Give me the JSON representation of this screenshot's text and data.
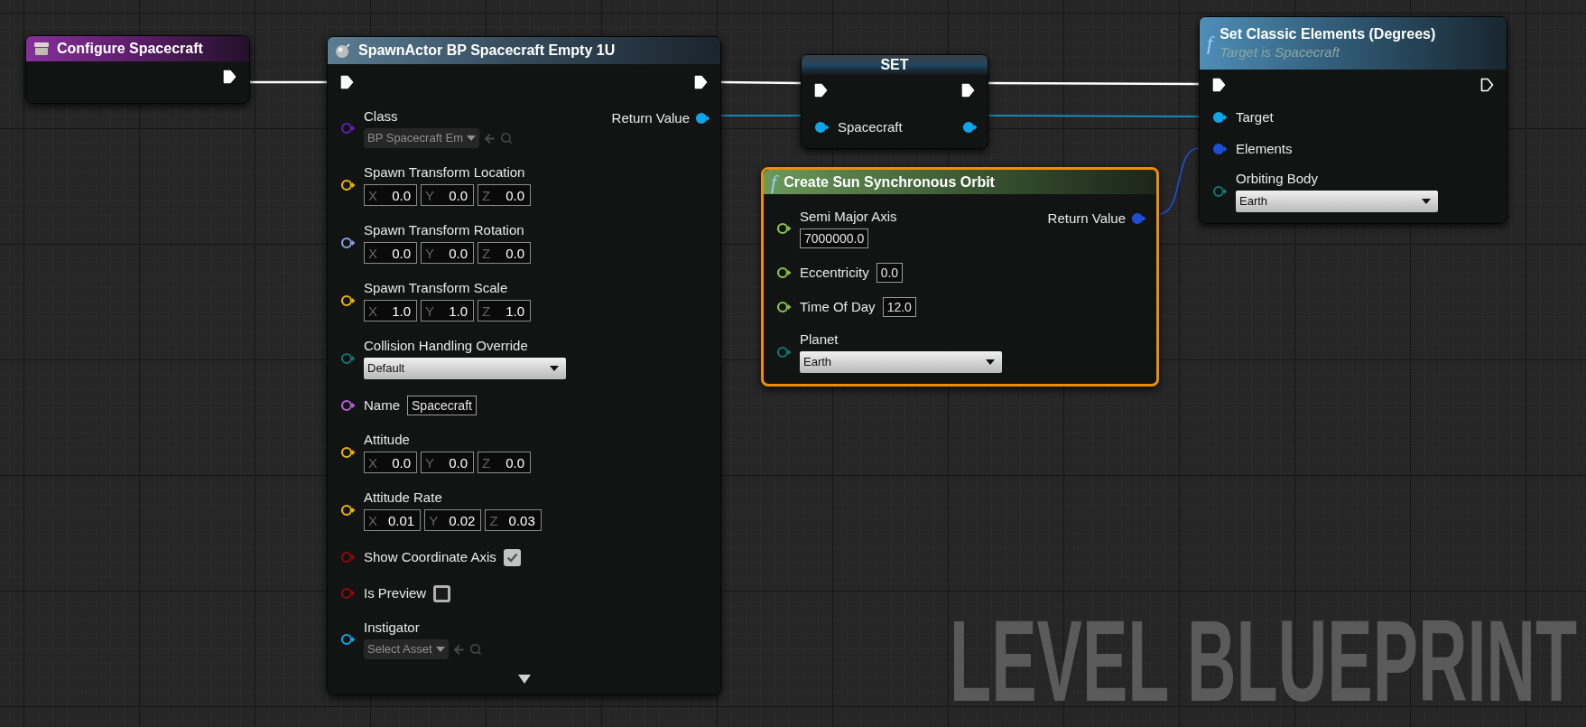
{
  "graph_label": "LEVEL BLUEPRINT",
  "nodes": [
    {
      "kind": "event",
      "title": "Configure Spacecraft",
      "selected": false,
      "exec_out": {
        "connected": true
      }
    },
    {
      "kind": "spawn",
      "title": "SpawnActor BP Spacecraft Empty 1U",
      "selected": false,
      "exec_in": {
        "connected": true
      },
      "exec_out": {
        "connected": true
      },
      "advanced_collapsed": true,
      "inputs": [
        {
          "kind": "class",
          "label": "Class",
          "color": "#5b21b6",
          "connected": false,
          "value": "BP Spacecraft Em"
        },
        {
          "kind": "vector",
          "label": "Spawn Transform Location",
          "color": "#eab308",
          "connected": false,
          "values": [
            {
              "axis": "X",
              "value": "0.0"
            },
            {
              "axis": "Y",
              "value": "0.0"
            },
            {
              "axis": "Z",
              "value": "0.0"
            }
          ]
        },
        {
          "kind": "vector",
          "label": "Spawn Transform Rotation",
          "color": "#8b9be0",
          "connected": false,
          "values": [
            {
              "axis": "X",
              "value": "0.0"
            },
            {
              "axis": "Y",
              "value": "0.0"
            },
            {
              "axis": "Z",
              "value": "0.0"
            }
          ]
        },
        {
          "kind": "vector",
          "label": "Spawn Transform Scale",
          "color": "#eab308",
          "connected": false,
          "values": [
            {
              "axis": "X",
              "value": "1.0"
            },
            {
              "axis": "Y",
              "value": "1.0"
            },
            {
              "axis": "Z",
              "value": "1.0"
            }
          ]
        },
        {
          "kind": "dropdown",
          "label": "Collision Handling Override",
          "color": "#0f766e",
          "connected": false,
          "value": "Default"
        },
        {
          "kind": "text",
          "label": "Name",
          "color": "#b45fd4",
          "connected": false,
          "value": "Spacecraft"
        },
        {
          "kind": "vector",
          "label": "Attitude",
          "color": "#eab308",
          "connected": false,
          "values": [
            {
              "axis": "X",
              "value": "0.0"
            },
            {
              "axis": "Y",
              "value": "0.0"
            },
            {
              "axis": "Z",
              "value": "0.0"
            }
          ]
        },
        {
          "kind": "vector",
          "label": "Attitude Rate",
          "color": "#eab308",
          "connected": false,
          "values": [
            {
              "axis": "X",
              "value": "0.01"
            },
            {
              "axis": "Y",
              "value": "0.02"
            },
            {
              "axis": "Z",
              "value": "0.03"
            }
          ]
        },
        {
          "kind": "bool",
          "label": "Show Coordinate Axis",
          "color": "#8b0a0a",
          "connected": false,
          "checked": true
        },
        {
          "kind": "bool",
          "label": "Is Preview",
          "color": "#8b0a0a",
          "connected": false,
          "checked": false
        },
        {
          "kind": "asset",
          "label": "Instigator",
          "color": "#0ea5e9",
          "connected": false,
          "placeholder": "Select Asset"
        }
      ],
      "outputs": [
        {
          "label": "Return Value",
          "color": "#0ea5e9",
          "connected": true
        }
      ]
    },
    {
      "kind": "variable_set",
      "title": "SET",
      "selected": false,
      "exec_in": {
        "connected": true
      },
      "exec_out": {
        "connected": true
      },
      "inputs": [
        {
          "kind": "object",
          "label": "Spacecraft",
          "color": "#0ea5e9",
          "connected": true
        }
      ],
      "outputs": [
        {
          "color": "#0ea5e9",
          "connected": true
        }
      ]
    },
    {
      "kind": "pure_function",
      "symbol": "f",
      "title": "Create Sun Synchronous Orbit",
      "selected": true,
      "inputs": [
        {
          "kind": "number",
          "label": "Semi Major Axis",
          "color": "#8bc34a",
          "connected": false,
          "value": "7000000.0"
        },
        {
          "kind": "number",
          "label": "Eccentricity",
          "color": "#8bc34a",
          "connected": false,
          "value": "0.0"
        },
        {
          "kind": "number",
          "label": "Time Of Day",
          "color": "#8bc34a",
          "connected": false,
          "value": "12.0"
        },
        {
          "kind": "dropdown",
          "label": "Planet",
          "color": "#0f766e",
          "connected": false,
          "value": "Earth"
        }
      ],
      "outputs": [
        {
          "label": "Return Value",
          "color": "#1d4ed8",
          "connected": true
        }
      ]
    },
    {
      "kind": "function",
      "symbol": "f",
      "title": "Set Classic Elements (Degrees)",
      "subtitle": "Target is Spacecraft",
      "selected": false,
      "exec_in": {
        "connected": true
      },
      "exec_out": {
        "connected": false
      },
      "inputs": [
        {
          "kind": "object",
          "label": "Target",
          "color": "#0ea5e9",
          "connected": true
        },
        {
          "kind": "struct",
          "label": "Elements",
          "color": "#1d4ed8",
          "connected": true
        },
        {
          "kind": "dropdown",
          "label": "Orbiting Body",
          "color": "#0f766e",
          "connected": false,
          "value": "Earth"
        }
      ]
    }
  ]
}
